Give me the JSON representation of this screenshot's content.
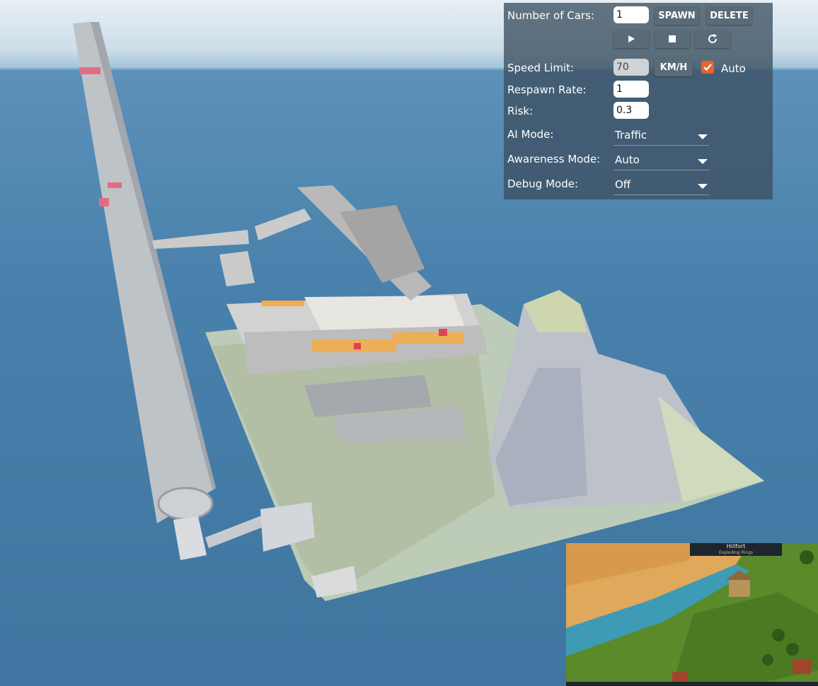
{
  "panel": {
    "number_of_cars_label": "Number of Cars:",
    "number_of_cars_value": "1",
    "spawn_label": "SPAWN",
    "delete_label": "DELETE",
    "play_icon": "play-icon",
    "stop_icon": "stop-icon",
    "reload_icon": "reload-icon",
    "speed_limit_label": "Speed Limit:",
    "speed_limit_value": "70",
    "speed_unit_label": "KM/H",
    "auto_label": "Auto",
    "auto_checked": true,
    "respawn_rate_label": "Respawn Rate:",
    "respawn_rate_value": "1",
    "risk_label": "Risk:",
    "risk_value": "0.3",
    "ai_mode_label": "AI Mode:",
    "ai_mode_value": "Traffic",
    "awareness_mode_label": "Awareness Mode:",
    "awareness_mode_value": "Auto",
    "debug_mode_label": "Debug Mode:",
    "debug_mode_value": "Off"
  },
  "inset": {
    "title": "Hillfort",
    "subtitle": "Exploding Rings"
  },
  "colors": {
    "panel_bg": "#3c5060",
    "checkbox_accent": "#e4652e",
    "ocean": "#3a77a6",
    "sky": "#e6eef5"
  }
}
